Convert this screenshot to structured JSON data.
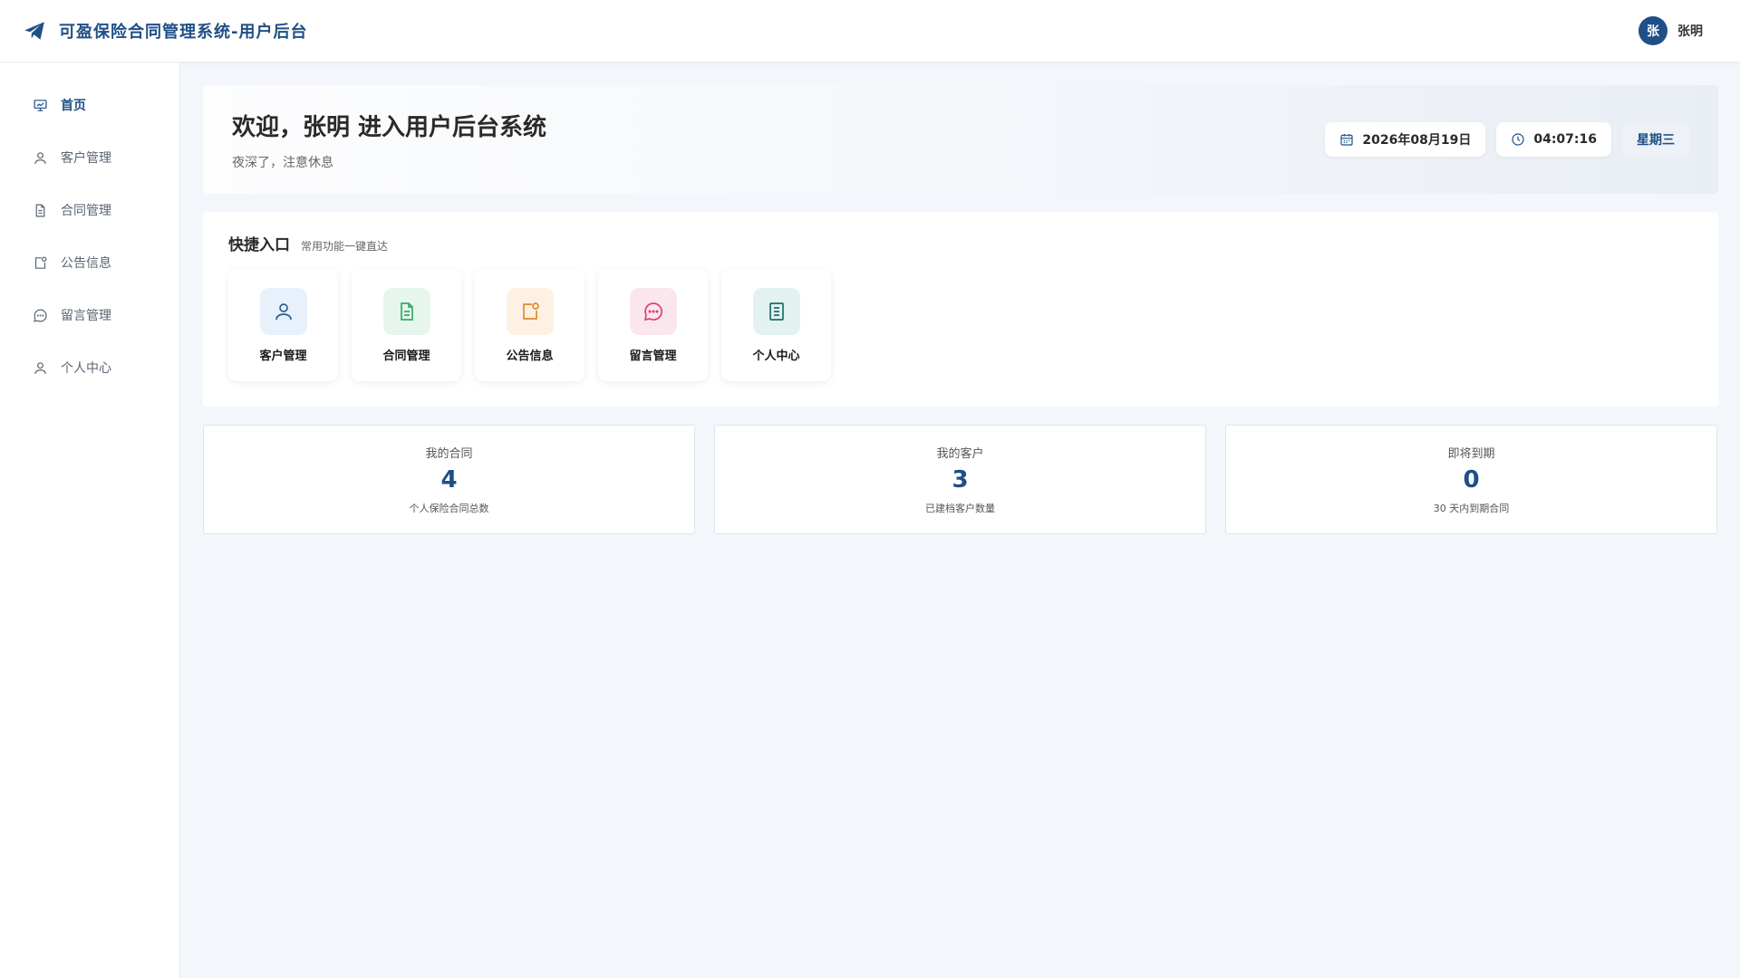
{
  "header": {
    "title": "可盈保险合同管理系统-用户后台",
    "brand_icon": "paper-plane-icon",
    "user_avatar_text": "张",
    "user_name": "张明"
  },
  "sidebar": {
    "items": [
      {
        "label": "首页",
        "icon": "dashboard-icon",
        "active": true
      },
      {
        "label": "客户管理",
        "icon": "user-icon"
      },
      {
        "label": "合同管理",
        "icon": "document-icon"
      },
      {
        "label": "公告信息",
        "icon": "notice-icon"
      },
      {
        "label": "留言管理",
        "icon": "message-icon"
      },
      {
        "label": "个人中心",
        "icon": "user-icon"
      }
    ]
  },
  "welcome": {
    "title": "欢迎，张明 进入用户后台系统",
    "subtitle": "夜深了，注意休息",
    "date": "2026年08月19日",
    "time": "04:07:16",
    "weekday": "星期三"
  },
  "quick": {
    "title": "快捷入口",
    "subtitle": "常用功能一键直达",
    "items": [
      {
        "label": "客户管理",
        "icon": "user-icon",
        "color": "#2e5e93",
        "bg": "#e8f1fb"
      },
      {
        "label": "合同管理",
        "icon": "document-icon",
        "color": "#2fae64",
        "bg": "#e6f6ec"
      },
      {
        "label": "公告信息",
        "icon": "notice-icon",
        "color": "#e48a2c",
        "bg": "#fdf1e3"
      },
      {
        "label": "留言管理",
        "icon": "message-icon",
        "color": "#dd3f7a",
        "bg": "#fbe6ee"
      },
      {
        "label": "个人中心",
        "icon": "profile-doc-icon",
        "color": "#1f6e68",
        "bg": "#e1f2f0"
      }
    ]
  },
  "stats": [
    {
      "title": "我的合同",
      "value": "4",
      "desc": "个人保险合同总数"
    },
    {
      "title": "我的客户",
      "value": "3",
      "desc": "已建档客户数量"
    },
    {
      "title": "即将到期",
      "value": "0",
      "desc": "30 天内到期合同"
    }
  ],
  "colors": {
    "primary": "#1f4f86",
    "background": "#f3f6fb"
  }
}
